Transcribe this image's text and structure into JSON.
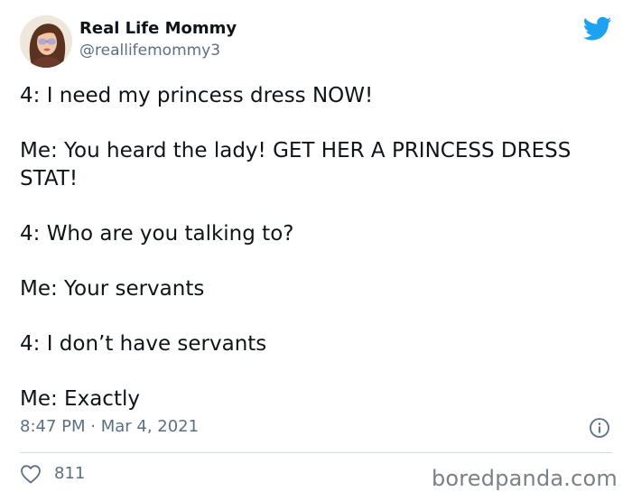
{
  "author": {
    "name": "Real Life Mommy",
    "handle": "@reallifemommy3",
    "avatar_icon": "avatar-photo"
  },
  "tweet": {
    "lines": [
      "4: I need my princess dress NOW!",
      "Me: You heard the lady! GET HER A PRINCESS DRESS STAT!",
      "4: Who are you talking to?",
      "Me: Your servants",
      "4: I don’t have servants",
      "Me: Exactly"
    ],
    "timestamp": "8:47 PM · Mar 4, 2021"
  },
  "engagement": {
    "likes": "811",
    "like_icon": "heart-outline-icon",
    "info_icon": "info-icon"
  },
  "branding": {
    "platform_icon": "twitter-bird-icon",
    "watermark": "boredpanda.com"
  },
  "colors": {
    "twitter_blue": "#1da1f2",
    "text_primary": "#0f1419",
    "text_secondary": "#5b7083",
    "divider": "#cfd9de"
  }
}
